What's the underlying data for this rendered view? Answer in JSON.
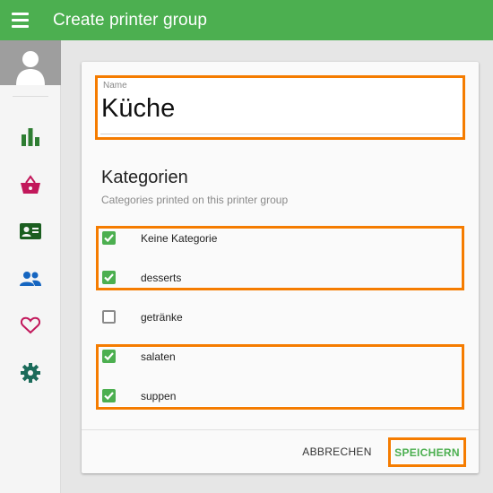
{
  "appbar": {
    "title": "Create printer group",
    "color": "#4caf50",
    "menu_icon": "hamburger-icon"
  },
  "sidebar": {
    "avatar_icon": "user-avatar-icon",
    "items": [
      {
        "icon": "bar-chart-icon",
        "color": "#2e7d32"
      },
      {
        "icon": "shopping-basket-icon",
        "color": "#c2185b"
      },
      {
        "icon": "contact-card-icon",
        "color": "#1b5e20"
      },
      {
        "icon": "people-icon",
        "color": "#1565c0"
      },
      {
        "icon": "heart-icon",
        "color": "#c2185b"
      },
      {
        "icon": "gear-icon",
        "color": "#1b6b5a"
      }
    ]
  },
  "form": {
    "name_label": "Name",
    "name_value": "Küche",
    "section_title": "Kategorien",
    "section_subtitle": "Categories printed on this printer group",
    "categories": [
      {
        "label": "Keine Kategorie",
        "checked": true
      },
      {
        "label": "desserts",
        "checked": true
      },
      {
        "label": "getränke",
        "checked": false
      },
      {
        "label": "salaten",
        "checked": true
      },
      {
        "label": "suppen",
        "checked": true
      }
    ],
    "cancel_label": "ABBRECHEN",
    "save_label": "SPEICHERN"
  },
  "colors": {
    "highlight": "#f57c00",
    "accent": "#4caf50"
  }
}
